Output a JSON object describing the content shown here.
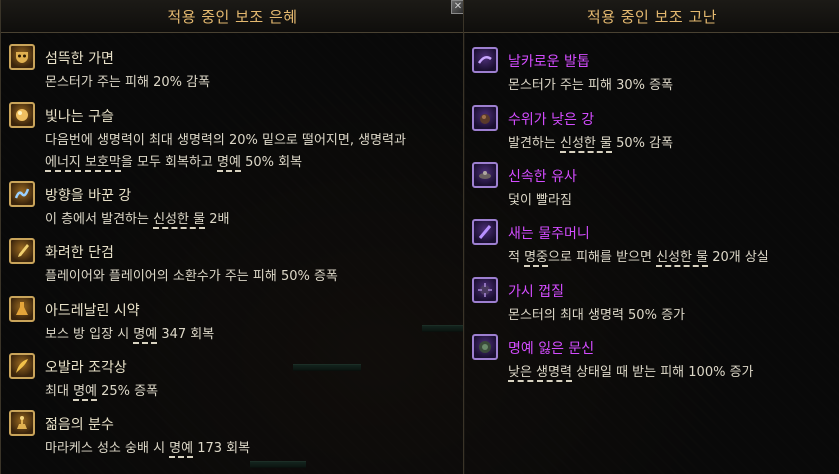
{
  "left_panel": {
    "title": "적용 중인 보조 은혜",
    "items": [
      {
        "icon": "mask-icon",
        "name": "섬뜩한 가면",
        "desc": [
          [
            "몬스터가 주는 피해 20% 감폭"
          ]
        ]
      },
      {
        "icon": "orb-icon",
        "name": "빛나는 구슬",
        "desc": [
          [
            "다음번에 생명력이 최대 생명력의 20% 밑으로 떨어지면, 생명력과"
          ],
          [
            "",
            "에너지 보호막",
            "을 모두 회복하고 ",
            "명예",
            " 50% 회복"
          ]
        ]
      },
      {
        "icon": "river-icon",
        "name": "방향을 바꾼 강",
        "desc": [
          [
            "이 층에서 발견하는 ",
            "신성한 물",
            " 2배"
          ]
        ]
      },
      {
        "icon": "dagger-icon",
        "name": "화려한 단검",
        "desc": [
          [
            "플레이어와 플레이어의 소환수가 주는 피해 50% 증폭"
          ]
        ]
      },
      {
        "icon": "flask-icon",
        "name": "아드레날린 시약",
        "desc": [
          [
            "보스 방 입장 시 ",
            "명예",
            " 347 회복"
          ]
        ]
      },
      {
        "icon": "feather-icon",
        "name": "오발라 조각상",
        "desc": [
          [
            "최대 ",
            "명예",
            " 25% 증폭"
          ]
        ]
      },
      {
        "icon": "fountain-icon",
        "name": "젊음의 분수",
        "desc": [
          [
            "마라케스 성소 숭배 시 ",
            "명예",
            " 173 회복"
          ]
        ]
      }
    ]
  },
  "right_panel": {
    "title": "적용 중인 보조 고난",
    "items": [
      {
        "icon": "claw-icon",
        "name": "날카로운 발톱",
        "desc": [
          [
            "몬스터가 주는 피해 30% 증폭"
          ]
        ]
      },
      {
        "icon": "water-icon",
        "name": "수위가 낮은 강",
        "desc": [
          [
            "발견하는 ",
            "신성한 물",
            " 50% 감폭"
          ]
        ]
      },
      {
        "icon": "quicksand-icon",
        "name": "신속한 유사",
        "desc": [
          [
            "덫이 빨라짐"
          ]
        ]
      },
      {
        "icon": "leech-icon",
        "name": "새는 물주머니",
        "desc": [
          [
            "적 ",
            "명중",
            "으로 피해를 받으면 ",
            "신성한 물",
            " 20개 상실"
          ]
        ]
      },
      {
        "icon": "thorn-icon",
        "name": "가시 껍질",
        "desc": [
          [
            "몬스터의 최대 생명력 50% 증가"
          ]
        ]
      },
      {
        "icon": "tattoo-icon",
        "name": "명예 잃은 문신",
        "desc": [
          [
            "",
            "낮은 생명력",
            " 상태일 때 받는 피해 100% 증가"
          ]
        ]
      }
    ]
  },
  "colors": {
    "title": "#e3b86f",
    "boon_name": "#e9e2c9",
    "affliction_name": "#d34cff",
    "text": "#ddd8c8"
  }
}
